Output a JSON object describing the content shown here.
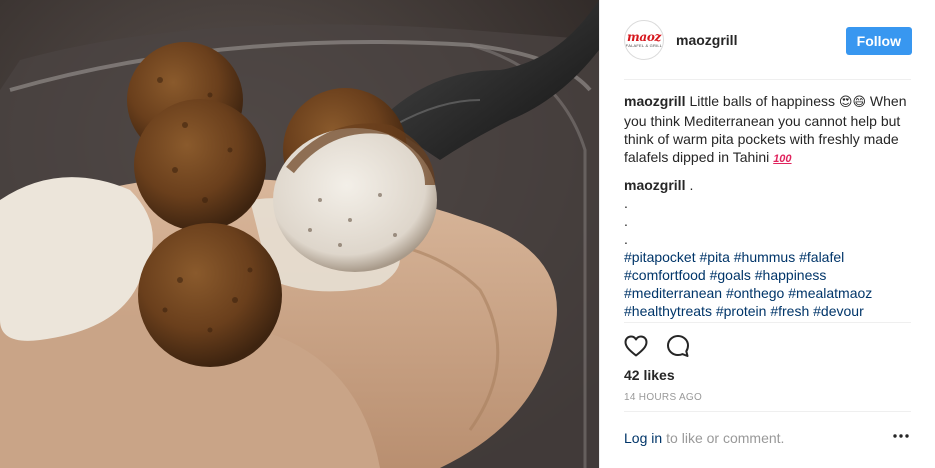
{
  "post": {
    "image_alt": "Falafel balls with tahini on pita bread in a plastic container with a black plastic spoon",
    "colors": {
      "accent": "#3897f0",
      "link": "#003569",
      "muted": "#999999",
      "brand_red": "#d6171d"
    }
  },
  "header": {
    "avatar_logo": "maoz",
    "avatar_logo_sub": "FALAFEL & GRILL",
    "username": "maozgrill",
    "follow_label": "Follow"
  },
  "caption": {
    "username": "maozgrill",
    "text": "Little balls of happiness",
    "emojis": [
      "😍",
      "😄"
    ],
    "text2": "When you think Mediterranean you cannot help but think of warm pita pockets with freshly made falafels dipped in Tahini",
    "emoji_end": "100"
  },
  "comment": {
    "username": "maozgrill",
    "first_line": ".",
    "dots": [
      ".",
      ".",
      "."
    ],
    "hashtags": [
      "#pitapocket",
      "#pita",
      "#hummus",
      "#falafel",
      "#comfortfood",
      "#goals",
      "#happiness",
      "#mediterranean",
      "#onthego",
      "#mealatmaoz",
      "#healthytreats",
      "#protein",
      "#fresh",
      "#devour"
    ]
  },
  "actions": {
    "like_icon": "heart-outline-icon",
    "comment_icon": "speech-bubble-icon"
  },
  "likes": "42 likes",
  "timestamp": "14 HOURS AGO",
  "footer": {
    "login_label": "Log in",
    "rest": "to like or comment.",
    "more_icon": "ellipsis-icon"
  }
}
